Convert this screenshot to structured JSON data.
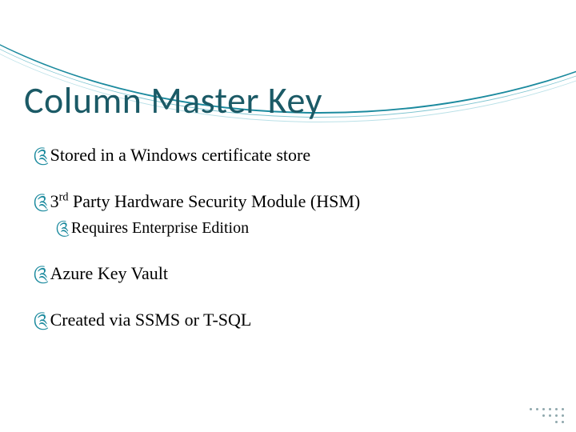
{
  "title": "Column Master Key",
  "bullets": {
    "b1": "Stored in a Windows certificate store",
    "b2_pre": "3",
    "b2_sup": "rd",
    "b2_post": " Party Hardware Security Module (HSM)",
    "b2a": "Requires Enterprise Edition",
    "b3": "Azure Key Vault",
    "b4": "Created via SSMS or T-SQL"
  },
  "bullet_glyph": "༊",
  "colors": {
    "accent": "#1b8a9e",
    "title": "#1b5a66"
  }
}
